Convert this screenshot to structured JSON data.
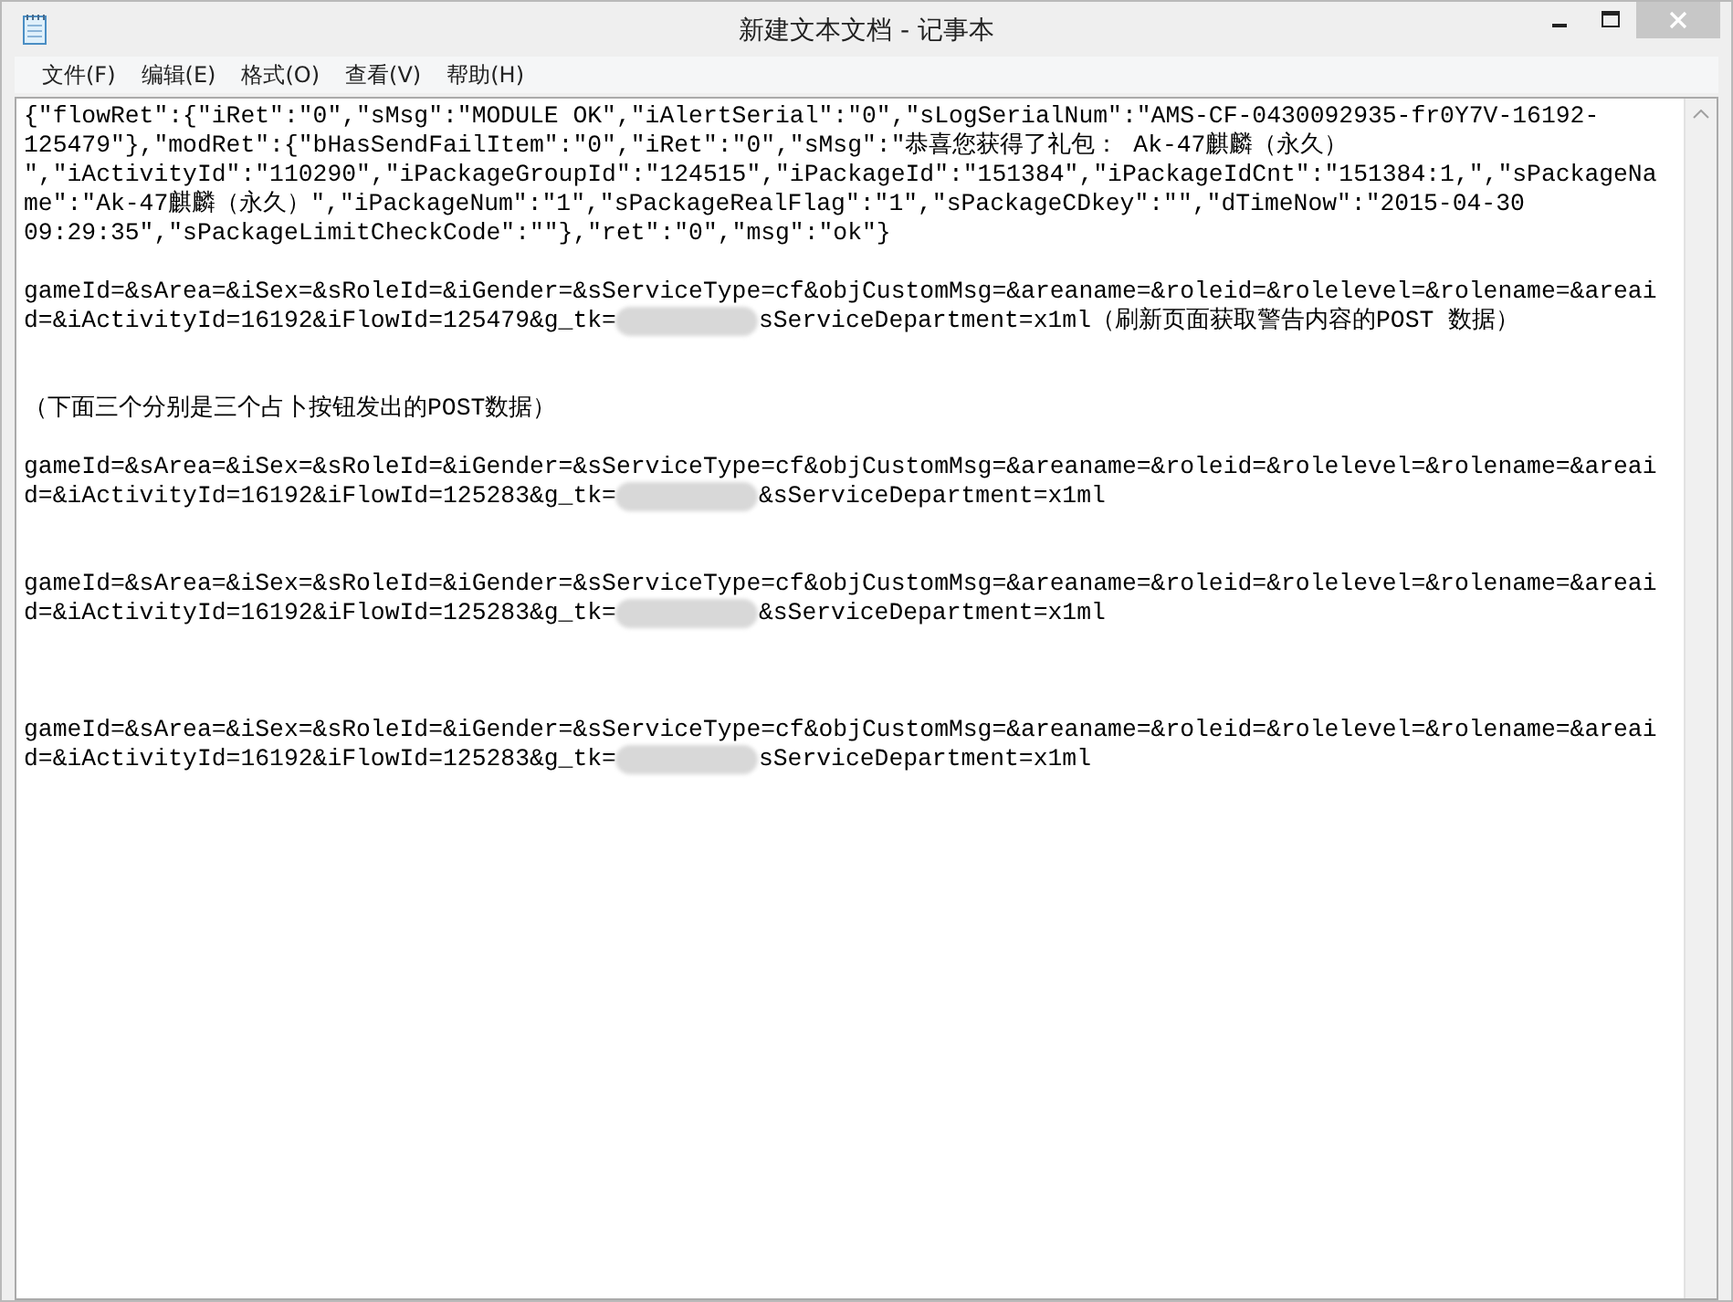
{
  "window": {
    "title": "新建文本文档 - 记事本"
  },
  "menu": [
    "文件(F)",
    "编辑(E)",
    "格式(O)",
    "查看(V)",
    "帮助(H)"
  ],
  "editor": {
    "lines": [
      {
        "kind": "text",
        "text": "{\"flowRet\":{\"iRet\":\"0\",\"sMsg\":\"MODULE OK\",\"iAlertSerial\":\"0\",\"sLogSerialNum\":\"AMS-CF-0430092935-fr0Y7V-16192-"
      },
      {
        "kind": "text",
        "text": "125479\"},\"modRet\":{\"bHasSendFailItem\":\"0\",\"iRet\":\"0\",\"sMsg\":\"恭喜您获得了礼包： Ak-47麒麟（永久）"
      },
      {
        "kind": "text",
        "text": "\",\"iActivityId\":\"110290\",\"iPackageGroupId\":\"124515\",\"iPackageId\":\"151384\",\"iPackageIdCnt\":\"151384:1,\",\"sPackageNa"
      },
      {
        "kind": "text",
        "text": "me\":\"Ak-47麒麟（永久）\",\"iPackageNum\":\"1\",\"sPackageRealFlag\":\"1\",\"sPackageCDkey\":\"\",\"dTimeNow\":\"2015-04-30"
      },
      {
        "kind": "text",
        "text": "09:29:35\",\"sPackageLimitCheckCode\":\"\"},\"ret\":\"0\",\"msg\":\"ok\"}"
      },
      {
        "kind": "blank"
      },
      {
        "kind": "text",
        "text": "gameId=&sArea=&iSex=&sRoleId=&iGender=&sServiceType=cf&objCustomMsg=&areaname=&roleid=&rolelevel=&rolename=&areai"
      },
      {
        "kind": "redacted",
        "before": "d=&iActivityId=16192&iFlowId=125479&g_tk=",
        "after": "sServiceDepartment=x1ml（刷新页面获取警告内容的POST 数据）"
      },
      {
        "kind": "blank"
      },
      {
        "kind": "blank"
      },
      {
        "kind": "text",
        "text": "（下面三个分别是三个占卜按钮发出的POST数据）"
      },
      {
        "kind": "blank"
      },
      {
        "kind": "text",
        "text": "gameId=&sArea=&iSex=&sRoleId=&iGender=&sServiceType=cf&objCustomMsg=&areaname=&roleid=&rolelevel=&rolename=&areai"
      },
      {
        "kind": "redacted",
        "before": "d=&iActivityId=16192&iFlowId=125283&g_tk=",
        "after": "&sServiceDepartment=x1ml"
      },
      {
        "kind": "blank"
      },
      {
        "kind": "blank"
      },
      {
        "kind": "text",
        "text": "gameId=&sArea=&iSex=&sRoleId=&iGender=&sServiceType=cf&objCustomMsg=&areaname=&roleid=&rolelevel=&rolename=&areai"
      },
      {
        "kind": "redacted",
        "before": "d=&iActivityId=16192&iFlowId=125283&g_tk=",
        "after": "&sServiceDepartment=x1ml"
      },
      {
        "kind": "blank"
      },
      {
        "kind": "blank"
      },
      {
        "kind": "blank"
      },
      {
        "kind": "text",
        "text": "gameId=&sArea=&iSex=&sRoleId=&iGender=&sServiceType=cf&objCustomMsg=&areaname=&roleid=&rolelevel=&rolename=&areai"
      },
      {
        "kind": "redacted",
        "before": "d=&iActivityId=16192&iFlowId=125283&g_tk=",
        "after": "sServiceDepartment=x1ml"
      }
    ]
  }
}
